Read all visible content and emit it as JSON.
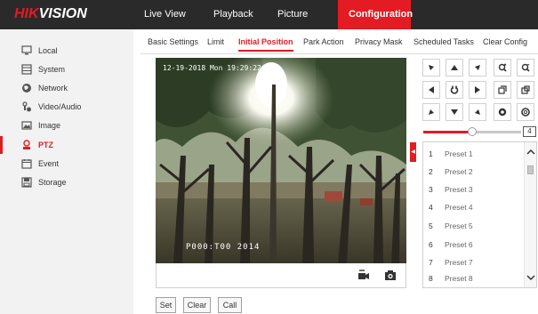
{
  "app": {
    "logo_part1": "HIK",
    "logo_part2": "VISION"
  },
  "topnav": [
    {
      "label": "Live View"
    },
    {
      "label": "Playback"
    },
    {
      "label": "Picture"
    },
    {
      "label": "Configuration",
      "active": true
    }
  ],
  "sidebar": {
    "items": [
      {
        "label": "Local",
        "icon": "monitor-icon"
      },
      {
        "label": "System",
        "icon": "system-icon"
      },
      {
        "label": "Network",
        "icon": "globe-icon"
      },
      {
        "label": "Video/Audio",
        "icon": "video-audio-icon"
      },
      {
        "label": "Image",
        "icon": "image-icon"
      },
      {
        "label": "PTZ",
        "icon": "ptz-icon",
        "active": true
      },
      {
        "label": "Event",
        "icon": "calendar-icon"
      },
      {
        "label": "Storage",
        "icon": "storage-icon"
      }
    ]
  },
  "subtabs": [
    {
      "label": "Basic Settings"
    },
    {
      "label": "Limit"
    },
    {
      "label": "Initial Position",
      "active": true
    },
    {
      "label": "Park Action"
    },
    {
      "label": "Privacy Mask"
    },
    {
      "label": "Scheduled Tasks"
    },
    {
      "label": "Clear Config"
    }
  ],
  "video": {
    "osd_timestamp": "12-19-2018 Mon 19:29:22",
    "osd_position": "P000:T00   2014",
    "controls": [
      "record-icon",
      "snapshot-icon"
    ]
  },
  "ptz": {
    "controls": [
      "arrow-up-left-icon",
      "arrow-up-icon",
      "arrow-up-right-icon",
      "zoom-in-icon",
      "zoom-out-icon",
      "arrow-left-icon",
      "auto-rotate-icon",
      "arrow-right-icon",
      "focus-near-icon",
      "focus-far-icon",
      "arrow-down-left-icon",
      "arrow-down-icon",
      "arrow-down-right-icon",
      "iris-open-icon",
      "iris-close-icon"
    ],
    "speed_value": "4",
    "speed_fraction": 0.5
  },
  "presets": [
    {
      "num": "1",
      "name": "Preset 1"
    },
    {
      "num": "2",
      "name": "Preset 2"
    },
    {
      "num": "3",
      "name": "Preset 3"
    },
    {
      "num": "4",
      "name": "Preset 4"
    },
    {
      "num": "5",
      "name": "Preset 5"
    },
    {
      "num": "6",
      "name": "Preset 6"
    },
    {
      "num": "7",
      "name": "Preset 7"
    },
    {
      "num": "8",
      "name": "Preset 8"
    }
  ],
  "buttons": {
    "set": "Set",
    "clear": "Clear",
    "call": "Call"
  },
  "colors": {
    "accent": "#e31b23",
    "topbar": "#2a2a2a",
    "sidebar": "#f2f2f2"
  }
}
